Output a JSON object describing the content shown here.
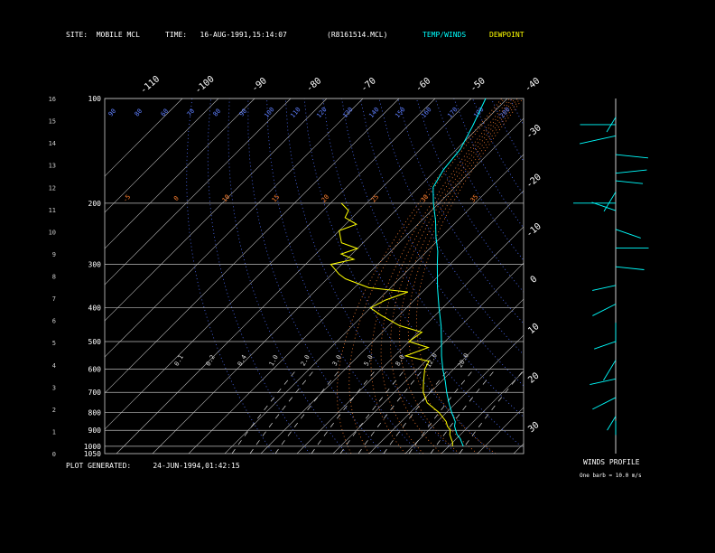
{
  "header": {
    "site_label": "SITE:",
    "site_value": "MOBILE MCL",
    "time_label": "TIME:",
    "time_value": "16-AUG-1991,15:14:07",
    "file_name": "(R8161514.MCL)",
    "legend_temp": "TEMP/WINDS",
    "legend_dew": "DEWPOINT",
    "temp_color": "#00ffff",
    "dew_color": "#ffff00"
  },
  "footer": {
    "generated_label": "PLOT GENERATED:",
    "generated_value": "24-JUN-1994,01:42:15"
  },
  "winds_profile": {
    "title": "WINDS PROFILE",
    "note": "One barb = 10.0 m/s"
  },
  "chart_data": {
    "type": "line",
    "title": "",
    "xlabel": "",
    "ylabel": "",
    "pressure_ticks": [
      "100",
      "200",
      "300",
      "400",
      "500",
      "600",
      "700",
      "800",
      "900",
      "1000",
      "1050"
    ],
    "height_ticks": [
      "16",
      "15",
      "14",
      "13",
      "12",
      "11",
      "10",
      "9",
      "8",
      "7",
      "6",
      "5",
      "4",
      "3",
      "2",
      "1",
      "0"
    ],
    "top_temp_ticks": [
      "-110",
      "-100",
      "-90",
      "-80",
      "-70",
      "-60",
      "-50",
      "-40"
    ],
    "right_temp_ticks": [
      "-30",
      "-20",
      "-10",
      "0",
      "10",
      "20",
      "30"
    ],
    "dry_adiabat_labels": [
      "90",
      "80",
      "60",
      "70",
      "80",
      "90",
      "100",
      "110",
      "120",
      "130",
      "140",
      "150",
      "160",
      "170",
      "190",
      "200"
    ],
    "mixing_ratio_labels": [
      "0.1",
      "0.2",
      "0.4",
      "1.0",
      "2.0",
      "3.0",
      "5.0",
      "8.0",
      "12.0",
      "20.0"
    ],
    "moist_adiabat_labels": [
      "-5",
      "0",
      "10",
      "15",
      "20",
      "25",
      "30",
      "35"
    ],
    "series": [
      {
        "name": "TEMP/WINDS",
        "color": "#00ffff",
        "points": [
          [
            1000,
            24
          ],
          [
            975,
            22.5
          ],
          [
            950,
            21
          ],
          [
            925,
            19
          ],
          [
            900,
            17.5
          ],
          [
            875,
            16
          ],
          [
            850,
            15
          ],
          [
            800,
            11.5
          ],
          [
            750,
            8
          ],
          [
            700,
            4.5
          ],
          [
            650,
            1
          ],
          [
            600,
            -3
          ],
          [
            550,
            -7
          ],
          [
            500,
            -11
          ],
          [
            450,
            -15.5
          ],
          [
            400,
            -21
          ],
          [
            350,
            -27
          ],
          [
            300,
            -33.5
          ],
          [
            275,
            -37
          ],
          [
            250,
            -41.5
          ],
          [
            225,
            -46
          ],
          [
            200,
            -51.5
          ],
          [
            180,
            -56
          ],
          [
            160,
            -58
          ],
          [
            140,
            -59
          ],
          [
            120,
            -62
          ],
          [
            100,
            -66
          ]
        ]
      },
      {
        "name": "DEWPOINT",
        "color": "#ffff00",
        "points": [
          [
            1000,
            21
          ],
          [
            975,
            20
          ],
          [
            950,
            18.5
          ],
          [
            925,
            17
          ],
          [
            900,
            16
          ],
          [
            875,
            14
          ],
          [
            850,
            12.5
          ],
          [
            800,
            8
          ],
          [
            750,
            2
          ],
          [
            700,
            -2
          ],
          [
            650,
            -5
          ],
          [
            600,
            -8
          ],
          [
            570,
            -9
          ],
          [
            550,
            -17
          ],
          [
            520,
            -13
          ],
          [
            500,
            -20
          ],
          [
            470,
            -19
          ],
          [
            450,
            -27
          ],
          [
            420,
            -35
          ],
          [
            400,
            -40
          ],
          [
            380,
            -38
          ],
          [
            360,
            -34
          ],
          [
            350,
            -46
          ],
          [
            330,
            -55
          ],
          [
            320,
            -58
          ],
          [
            300,
            -63
          ],
          [
            290,
            -58
          ],
          [
            280,
            -63
          ],
          [
            270,
            -60
          ],
          [
            260,
            -66
          ],
          [
            240,
            -70
          ],
          [
            230,
            -67
          ],
          [
            220,
            -72
          ],
          [
            210,
            -73
          ],
          [
            200,
            -77
          ]
        ]
      }
    ],
    "wind_profile": [
      [
        1000,
        0,
        4
      ],
      [
        950,
        200,
        5
      ],
      [
        900,
        230,
        9
      ],
      [
        850,
        250,
        7
      ],
      [
        800,
        200,
        13
      ],
      [
        750,
        240,
        5
      ],
      [
        700,
        180,
        11
      ],
      [
        650,
        230,
        9
      ],
      [
        600,
        250,
        5
      ],
      [
        550,
        100,
        8
      ],
      [
        500,
        90,
        11
      ],
      [
        450,
        120,
        8
      ],
      [
        400,
        300,
        7
      ],
      [
        380,
        270,
        18
      ],
      [
        350,
        200,
        12
      ],
      [
        320,
        100,
        7
      ],
      [
        300,
        80,
        10
      ],
      [
        250,
        100,
        11
      ],
      [
        200,
        250,
        15
      ],
      [
        170,
        270,
        13
      ],
      [
        150,
        200,
        6
      ]
    ]
  }
}
